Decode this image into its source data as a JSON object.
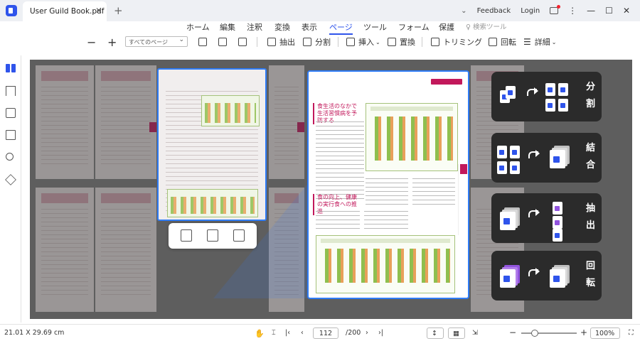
{
  "titlebar": {
    "tab_title": "User Guild Book.pdf",
    "feedback": "Feedback",
    "login": "Login"
  },
  "menu": {
    "items": [
      "ホーム",
      "編集",
      "注釈",
      "変換",
      "表示",
      "ページ",
      "ツール",
      "フォーム",
      "保護"
    ],
    "active_index": 5,
    "search_tools": "検索ツール"
  },
  "toolbar": {
    "page_range": "すべてのページ",
    "extract": "抽出",
    "split": "分割",
    "insert": "挿入",
    "replace": "置換",
    "trim": "トリミング",
    "rotate": "回転",
    "details": "詳細"
  },
  "features": [
    {
      "label": "分割",
      "icon": "split-pages-icon"
    },
    {
      "label": "結合",
      "icon": "merge-pages-icon"
    },
    {
      "label": "抽出",
      "icon": "extract-pages-icon"
    },
    {
      "label": "回転",
      "icon": "rotate-pages-icon"
    }
  ],
  "document": {
    "zoom_title": "食生活のなかで生活習慣病を予防する",
    "zoom_heading": "食の向上、健康の実行食への推進"
  },
  "statusbar": {
    "page_size": "21.01 X 29.69 cm",
    "current_page": "112",
    "total_pages": "/200",
    "zoom": "100%"
  },
  "colors": {
    "accent": "#2f54eb",
    "selection": "#2f7cf6",
    "doc_accent": "#c2185b",
    "card_bg": "#2b2b2b"
  }
}
